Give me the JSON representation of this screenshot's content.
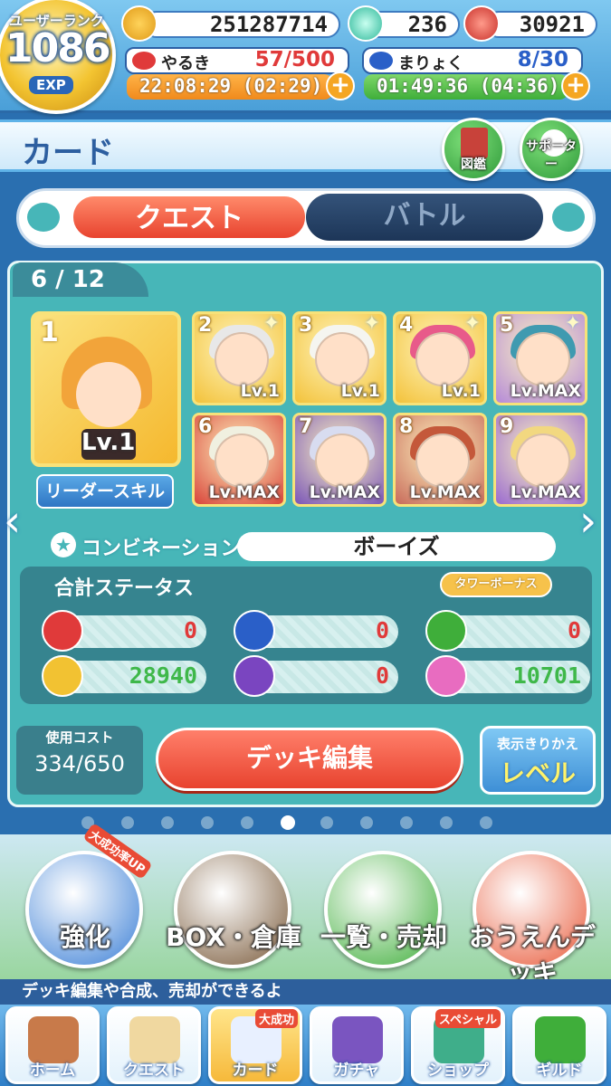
{
  "user": {
    "rank_label": "ユーザーランク",
    "rank": "1086",
    "exp_label": "EXP"
  },
  "resources": {
    "coins": "251287714",
    "gems": "236",
    "tickets": "30921"
  },
  "stamina": {
    "label": "やるき",
    "value": "57/500",
    "timer": "22:08:29 (02:29)"
  },
  "magic": {
    "label": "まりょく",
    "value": "8/30",
    "timer": "01:49:36 (04:36)"
  },
  "header": {
    "title": "カード",
    "zukan": "図鑑",
    "supporter": "サポーター"
  },
  "tabs": [
    {
      "label": "クエスト",
      "active": true
    },
    {
      "label": "バトル",
      "active": false
    }
  ],
  "deck": {
    "counter": "6 / 12"
  },
  "leader": {
    "no": "1",
    "level": "Lv.1",
    "skill_button": "リーダースキル"
  },
  "cards": [
    {
      "no": "2",
      "level": "Lv.1",
      "star": true,
      "bg": "#f3c23a",
      "hair": "#e8e8e8"
    },
    {
      "no": "3",
      "level": "Lv.1",
      "star": true,
      "bg": "#f3c23a",
      "hair": "#f5f5f0"
    },
    {
      "no": "4",
      "level": "Lv.1",
      "star": true,
      "bg": "#f3c23a",
      "hair": "#e85a8a"
    },
    {
      "no": "5",
      "level": "Lv.MAX",
      "star": true,
      "bg": "#b58ad8",
      "hair": "#3f9ab0"
    },
    {
      "no": "6",
      "level": "Lv.MAX",
      "star": false,
      "bg": "#d9443a",
      "hair": "#f0f0e0"
    },
    {
      "no": "7",
      "level": "Lv.MAX",
      "star": false,
      "bg": "#7a55b8",
      "hair": "#d8dcf0"
    },
    {
      "no": "8",
      "level": "Lv.MAX",
      "star": false,
      "bg": "#c86a5a",
      "hair": "#c4583a"
    },
    {
      "no": "9",
      "level": "Lv.MAX",
      "star": false,
      "bg": "#9a6ad0",
      "hair": "#f2d880"
    }
  ],
  "combination": {
    "label": "コンビネーション!",
    "value": "ボーイズ"
  },
  "status": {
    "title": "合計ステータス",
    "tower_bonus": "タワーボーナス",
    "values": [
      {
        "icon": "red-puyo-icon",
        "color": "#e03a3a",
        "value": "0"
      },
      {
        "icon": "blue-puyo-icon",
        "color": "#2a5fc8",
        "value": "0"
      },
      {
        "icon": "green-puyo-icon",
        "color": "#3fae3a",
        "value": "0"
      },
      {
        "icon": "yellow-puyo-icon",
        "color": "#f2c232",
        "value": "28940"
      },
      {
        "icon": "purple-puyo-icon",
        "color": "#7a45c0",
        "value": "0"
      },
      {
        "icon": "heart-icon",
        "color": "#e86cc0",
        "value": "10701"
      }
    ]
  },
  "cost": {
    "label": "使用コスト",
    "value": "334/650"
  },
  "deck_edit": "デッキ編集",
  "toggle": {
    "line1": "表示きりかえ",
    "line2": "レベル"
  },
  "pages": {
    "count": 11,
    "active": 6
  },
  "menu": [
    {
      "label": "強化",
      "badge": "大成功率UP",
      "color": "#3b7fd6"
    },
    {
      "label": "BOX・倉庫",
      "badge": "",
      "color": "#7a5a3a"
    },
    {
      "label": "一覧・売却",
      "badge": "",
      "color": "#3fae3a"
    },
    {
      "label": "おうえんデッキ",
      "badge": "",
      "color": "#e85a3a"
    }
  ],
  "ticker": "デッキ編集や合成、売却ができるよ",
  "nav": [
    {
      "label": "ホーム",
      "badge": ""
    },
    {
      "label": "クエスト",
      "badge": ""
    },
    {
      "label": "カード",
      "badge": "大成功"
    },
    {
      "label": "ガチャ",
      "badge": ""
    },
    {
      "label": "ショップ",
      "badge": "スペシャル"
    },
    {
      "label": "ギルド",
      "badge": ""
    }
  ]
}
